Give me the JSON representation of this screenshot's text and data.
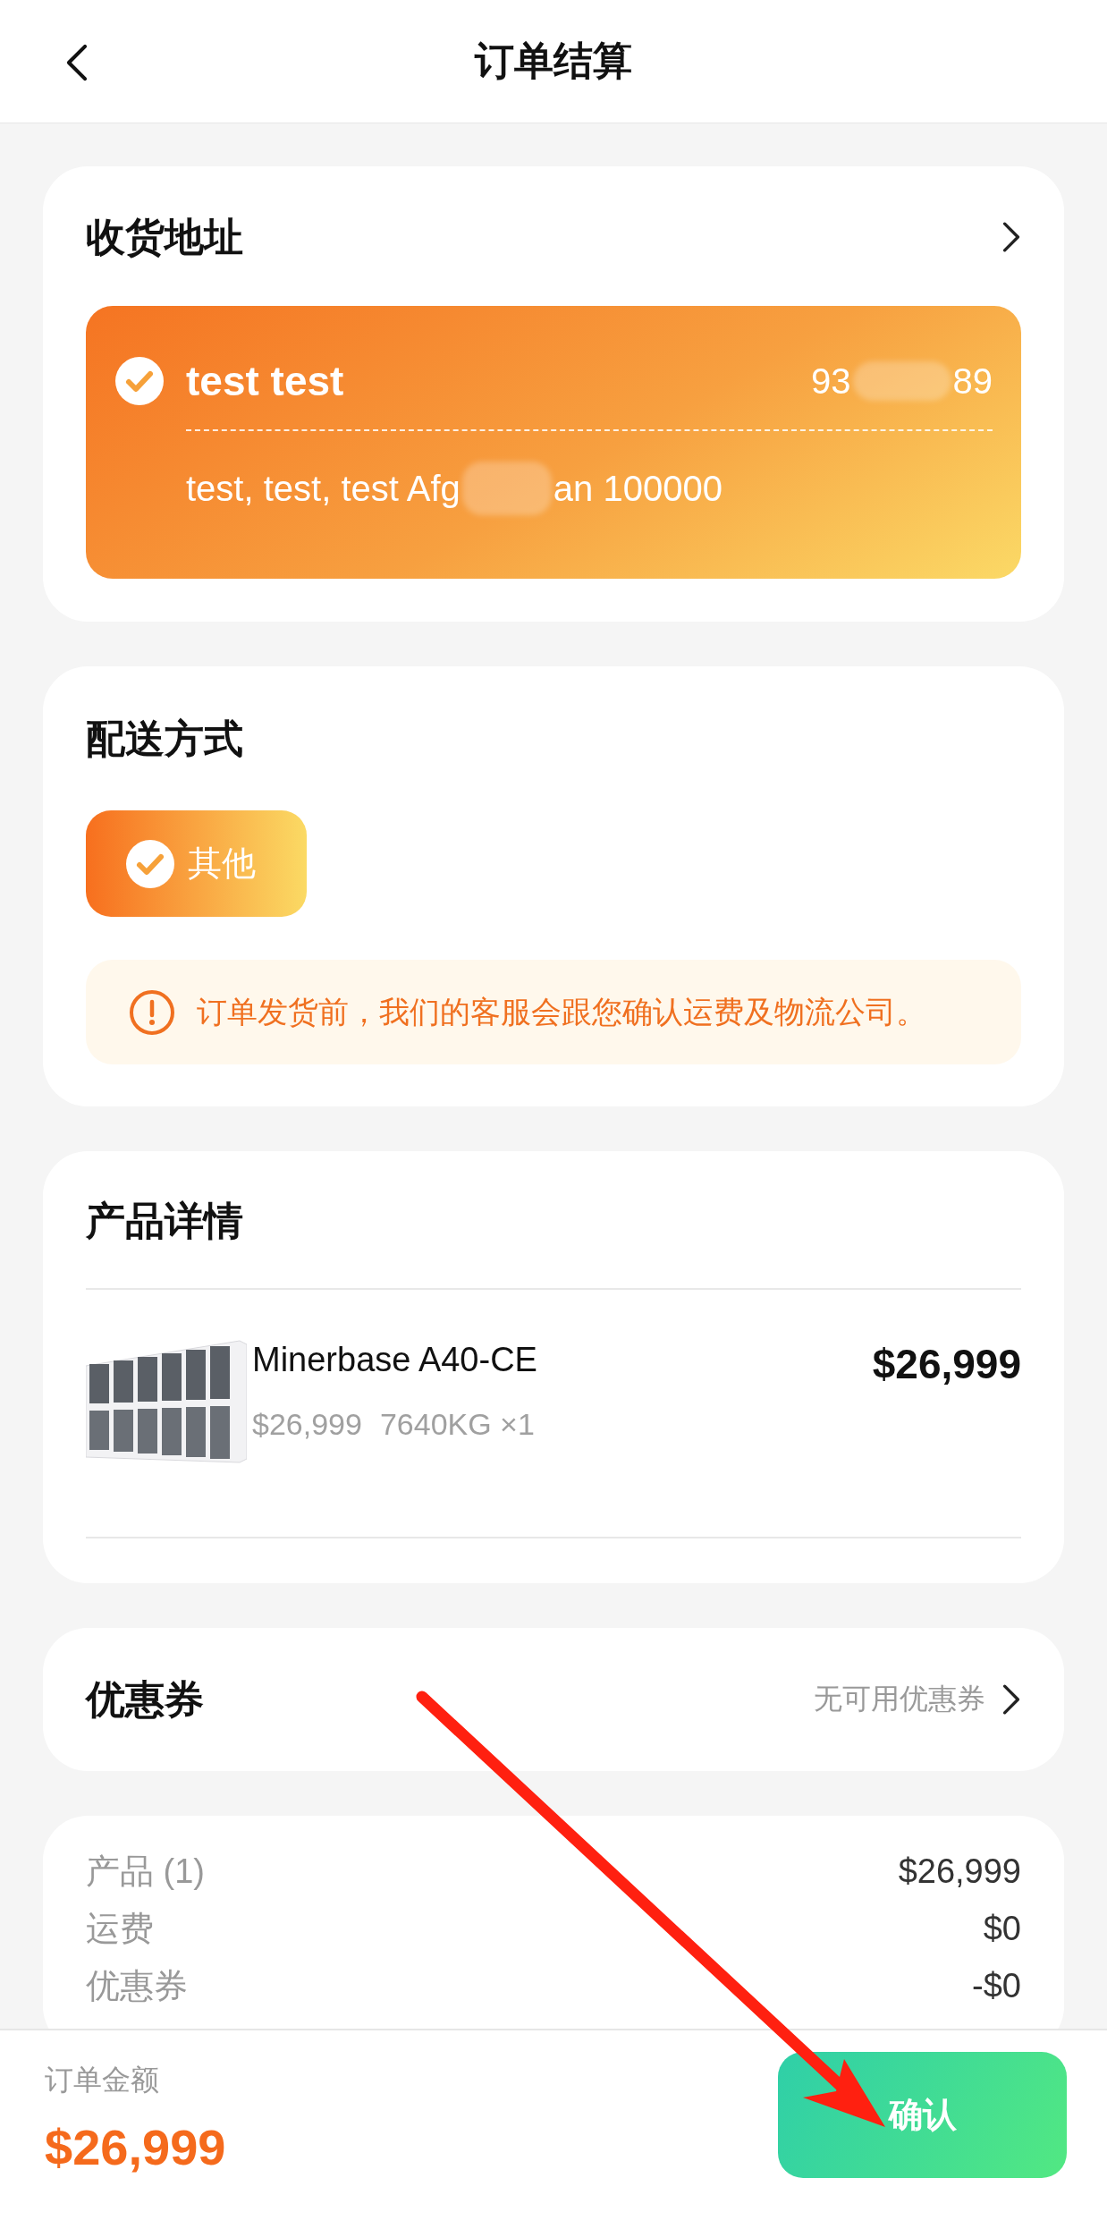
{
  "header": {
    "title": "订单结算"
  },
  "address": {
    "title": "收货地址",
    "selected": true,
    "name": "test test",
    "phone_start": "93",
    "phone_end": "89",
    "address_start": "test, test, test Afg",
    "address_end": "an 100000"
  },
  "delivery": {
    "title": "配送方式",
    "options": [
      {
        "label": "其他",
        "selected": true
      }
    ],
    "notice": "订单发货前，我们的客服会跟您确认运费及物流公司。"
  },
  "products": {
    "title": "产品详情",
    "items": [
      {
        "name": "Minerbase A40-CE",
        "unit_price": "$26,999",
        "weight": "7640KG",
        "quantity": "×1",
        "total": "$26,999"
      }
    ]
  },
  "coupon": {
    "title": "优惠券",
    "value": "无可用优惠券"
  },
  "summary": {
    "rows": [
      {
        "label": "产品 (1)",
        "value": "$26,999"
      },
      {
        "label": "运费",
        "value": "$0"
      },
      {
        "label": "优惠券",
        "value": "-$0"
      }
    ]
  },
  "footer": {
    "label": "订单金额",
    "total": "$26,999",
    "button": "确认"
  }
}
